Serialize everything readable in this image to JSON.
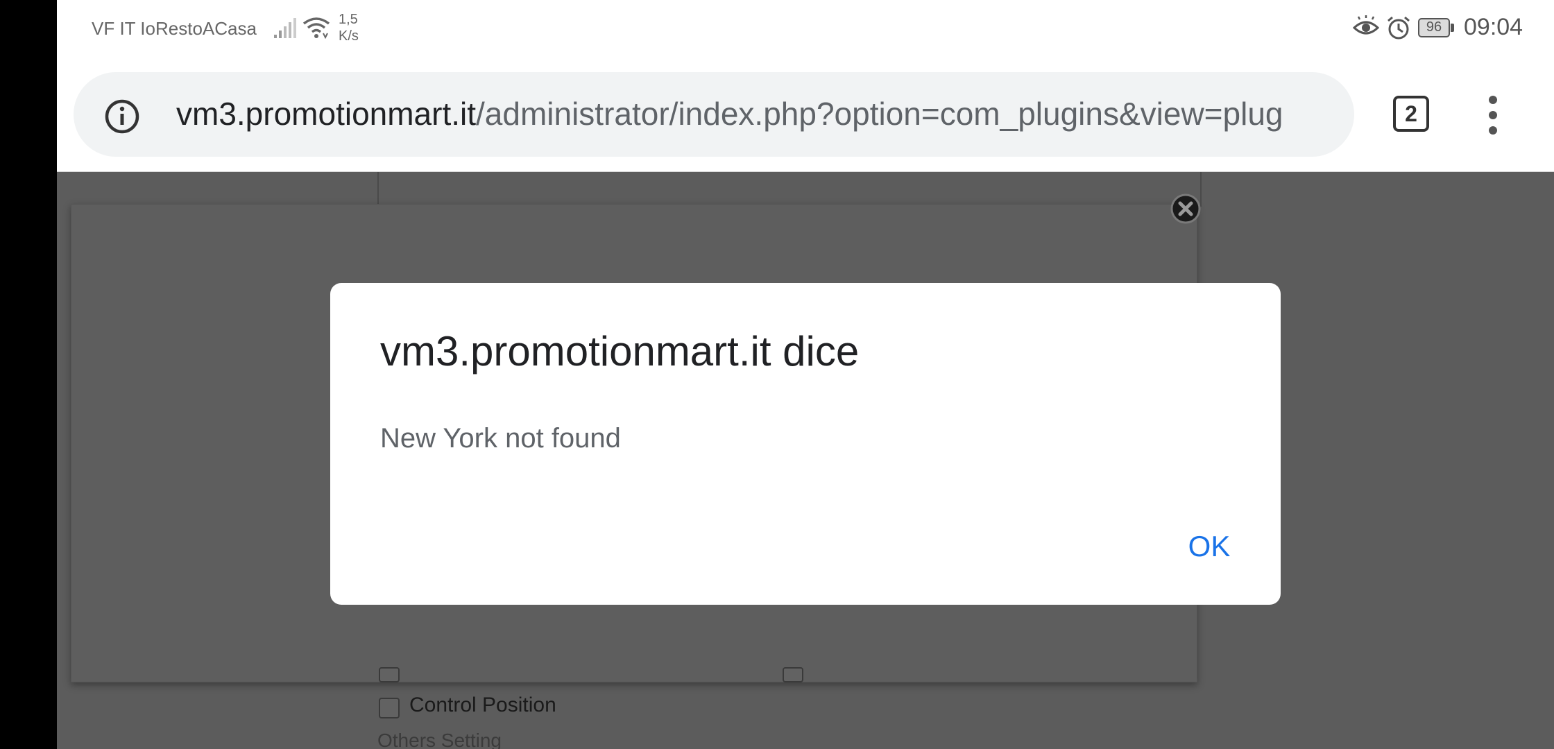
{
  "status_bar": {
    "carrier": "VF IT IoRestoACasa",
    "speed_value": "1,5",
    "speed_unit": "K/s",
    "battery": "96",
    "time": "09:04"
  },
  "browser": {
    "url_host": "vm3.promotionmart.it",
    "url_path": "/administrator/index.php?option=com_plugins&view=plug",
    "tab_count": "2"
  },
  "page": {
    "control_position_label": "Control Position",
    "others_setting_label": "Others Setting"
  },
  "dialog": {
    "title": "vm3.promotionmart.it dice",
    "message": "New York not found",
    "ok_label": "OK"
  },
  "colors": {
    "accent": "#1a73e8",
    "scrim": "#5c5c5c"
  }
}
